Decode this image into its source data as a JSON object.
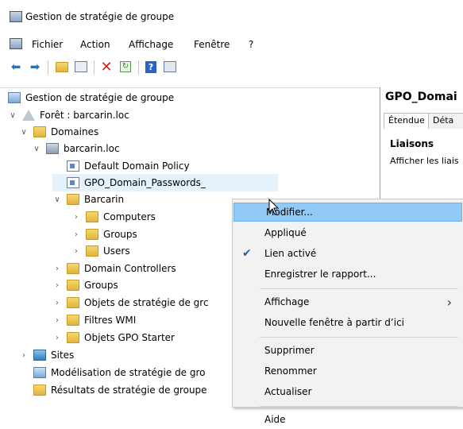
{
  "window": {
    "title": "Gestion de stratégie de groupe"
  },
  "menu": [
    "Fichier",
    "Action",
    "Affichage",
    "Fenêtre",
    "?"
  ],
  "tree": [
    {
      "label": "Gestion de stratégie de groupe",
      "level": 0,
      "arrow": "",
      "icon": "gpmc-console-icon"
    },
    {
      "label": "Forêt : barcarin.loc",
      "level": 1,
      "arrow": "expanded",
      "icon": "forest-icon"
    },
    {
      "label": "Domaines",
      "level": 2,
      "arrow": "expanded",
      "icon": "domains-folder-icon"
    },
    {
      "label": "barcarin.loc",
      "level": 3,
      "arrow": "expanded",
      "icon": "domain-icon"
    },
    {
      "label": "Default Domain Policy",
      "level": 4,
      "arrow": "",
      "icon": "gpo-link-icon"
    },
    {
      "label": "GPO_Domain_Passwords_",
      "level": 4,
      "arrow": "",
      "icon": "gpo-link-icon",
      "selected": true
    },
    {
      "label": "Barcarin",
      "level": 4,
      "arrow": "expanded",
      "icon": "ou-folder-icon"
    },
    {
      "label": "Computers",
      "level": 5,
      "arrow": "collapsed",
      "icon": "ou-folder-icon"
    },
    {
      "label": "Groups",
      "level": 5,
      "arrow": "collapsed",
      "icon": "ou-folder-icon"
    },
    {
      "label": "Users",
      "level": 5,
      "arrow": "collapsed",
      "icon": "ou-folder-icon"
    },
    {
      "label": "Domain Controllers",
      "level": 4,
      "arrow": "collapsed",
      "icon": "ou-folder-icon"
    },
    {
      "label": "Groups",
      "level": 4,
      "arrow": "collapsed",
      "icon": "ou-folder-icon"
    },
    {
      "label": "Objets de stratégie de grc",
      "level": 4,
      "arrow": "collapsed",
      "icon": "gpo-folder-icon"
    },
    {
      "label": "Filtres WMI",
      "level": 4,
      "arrow": "collapsed",
      "icon": "wmi-folder-icon"
    },
    {
      "label": "Objets GPO Starter",
      "level": 4,
      "arrow": "collapsed",
      "icon": "starter-folder-icon"
    },
    {
      "label": "Sites",
      "level": 2,
      "arrow": "collapsed",
      "icon": "sites-icon"
    },
    {
      "label": "Modélisation de stratégie de gro",
      "level": 2,
      "arrow": "",
      "icon": "modeling-icon"
    },
    {
      "label": "Résultats de stratégie de groupe",
      "level": 2,
      "arrow": "",
      "icon": "results-icon"
    }
  ],
  "right_panel": {
    "title": "GPO_Domai",
    "tabs": [
      "Étendue",
      "Déta"
    ],
    "section": "Liaisons",
    "subtext": "Afficher les liais"
  },
  "context_menu": {
    "items": [
      {
        "label": "Modifier...",
        "highlighted": true
      },
      {
        "label": "Appliqué"
      },
      {
        "label": "Lien activé",
        "checked": true
      },
      {
        "label": "Enregistrer le rapport..."
      },
      {
        "separator": true
      },
      {
        "label": "Affichage",
        "submenu": true
      },
      {
        "label": "Nouvelle fenêtre à partir d’ici"
      },
      {
        "separator": true
      },
      {
        "label": "Supprimer"
      },
      {
        "label": "Renommer"
      },
      {
        "label": "Actualiser"
      },
      {
        "separator": true
      },
      {
        "label": "Aide"
      }
    ]
  },
  "colors": {
    "highlight": "#91c9f7",
    "selection": "#e5f1fb",
    "check": "#1d5fb2"
  }
}
